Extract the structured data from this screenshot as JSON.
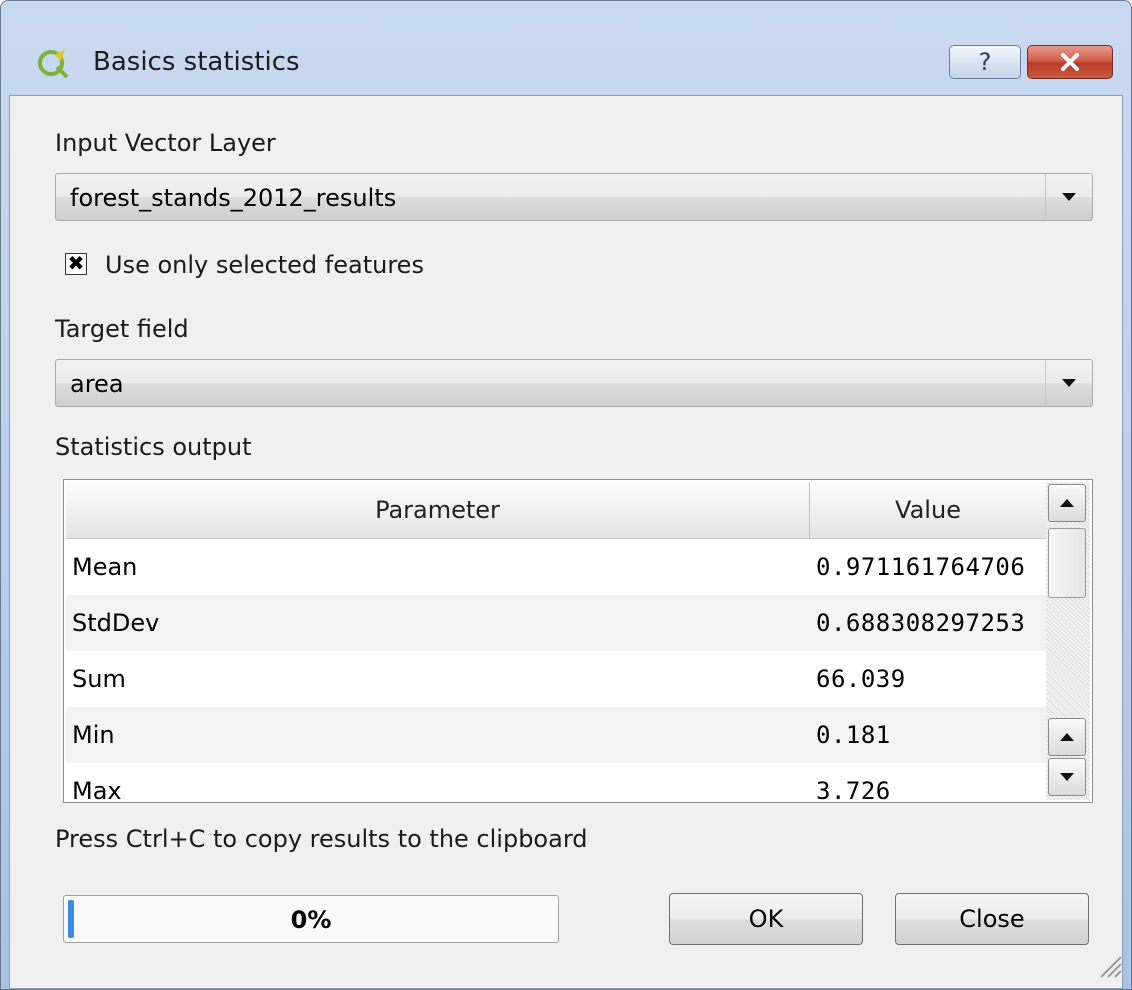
{
  "window": {
    "title": "Basics statistics",
    "app_icon": "qgis-logo-icon",
    "help_label": "?",
    "close_icon": "close-icon"
  },
  "input_layer": {
    "label": "Input Vector Layer",
    "value": "forest_stands_2012_results"
  },
  "selected_only": {
    "label": "Use only selected features",
    "checked": true,
    "mark": "✖"
  },
  "target_field": {
    "label": "Target field",
    "value": "area"
  },
  "statistics": {
    "label": "Statistics output",
    "columns": [
      "Parameter",
      "Value"
    ],
    "rows": [
      {
        "parameter": "Mean",
        "value": "0.971161764706"
      },
      {
        "parameter": "StdDev",
        "value": "0.688308297253"
      },
      {
        "parameter": "Sum",
        "value": "66.039"
      },
      {
        "parameter": "Min",
        "value": "0.181"
      },
      {
        "parameter": "Max",
        "value": "3.726"
      }
    ]
  },
  "hint": "Press Ctrl+C to copy results to the clipboard",
  "progress": {
    "text": "0%",
    "value": 0,
    "color": "#3b8be0"
  },
  "buttons": {
    "ok": "OK",
    "close": "Close"
  }
}
